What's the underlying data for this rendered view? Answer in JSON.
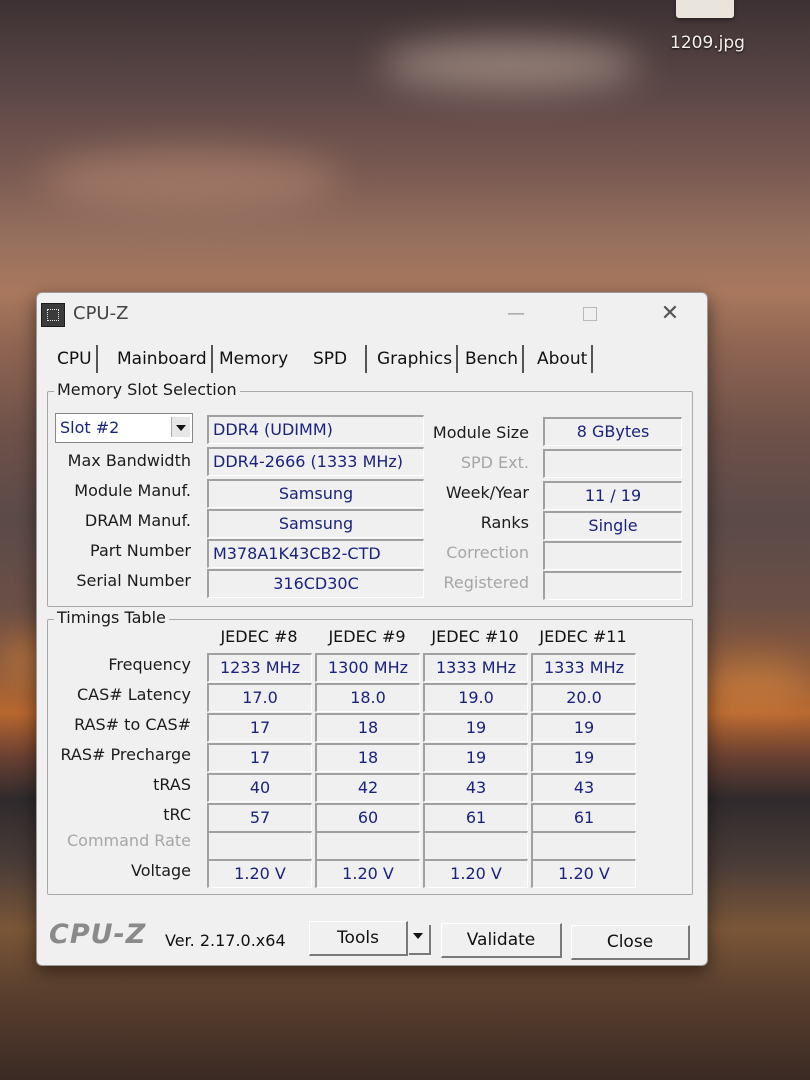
{
  "desktop": {
    "file_label": "1209.jpg"
  },
  "window": {
    "title": "CPU-Z",
    "controls": {
      "minimize": "—",
      "close": "✕"
    }
  },
  "tabs": [
    "CPU",
    "Mainboard",
    "Memory",
    "SPD",
    "Graphics",
    "Bench",
    "About"
  ],
  "active_tab": "SPD",
  "slot_selection": {
    "group_label": "Memory Slot Selection",
    "slot": "Slot #2",
    "memory_type": "DDR4 (UDIMM)",
    "labels": {
      "max_bandwidth": "Max Bandwidth",
      "module_manuf": "Module Manuf.",
      "dram_manuf": "DRAM Manuf.",
      "part_number": "Part Number",
      "serial_number": "Serial Number",
      "module_size": "Module Size",
      "spd_ext": "SPD Ext.",
      "week_year": "Week/Year",
      "ranks": "Ranks",
      "correction": "Correction",
      "registered": "Registered"
    },
    "values": {
      "max_bandwidth": "DDR4-2666 (1333 MHz)",
      "module_manuf": "Samsung",
      "dram_manuf": "Samsung",
      "part_number": "M378A1K43CB2-CTD",
      "serial_number": "316CD30C",
      "module_size": "8 GBytes",
      "spd_ext": "",
      "week_year": "11 / 19",
      "ranks": "Single",
      "correction": "",
      "registered": ""
    }
  },
  "timings": {
    "group_label": "Timings Table",
    "columns": [
      "JEDEC #8",
      "JEDEC #9",
      "JEDEC #10",
      "JEDEC #11"
    ],
    "row_labels": [
      "Frequency",
      "CAS# Latency",
      "RAS# to CAS#",
      "RAS# Precharge",
      "tRAS",
      "tRC",
      "Command Rate",
      "Voltage"
    ],
    "rows": [
      [
        "1233 MHz",
        "1300 MHz",
        "1333 MHz",
        "1333 MHz"
      ],
      [
        "17.0",
        "18.0",
        "19.0",
        "20.0"
      ],
      [
        "17",
        "18",
        "19",
        "19"
      ],
      [
        "17",
        "18",
        "19",
        "19"
      ],
      [
        "40",
        "42",
        "43",
        "43"
      ],
      [
        "57",
        "60",
        "61",
        "61"
      ],
      [
        "",
        "",
        "",
        ""
      ],
      [
        "1.20 V",
        "1.20 V",
        "1.20 V",
        "1.20 V"
      ]
    ]
  },
  "footer": {
    "brand": "CPU-Z",
    "version": "Ver. 2.17.0.x64",
    "tools_label": "Tools",
    "validate_label": "Validate",
    "close_label": "Close"
  }
}
